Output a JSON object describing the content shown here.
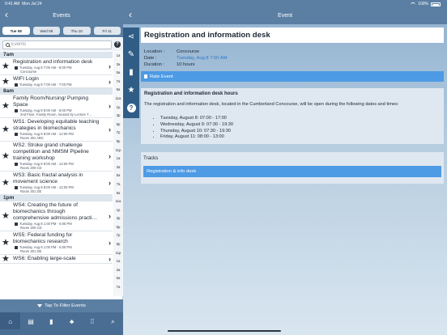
{
  "status_bar": {
    "time": "9:41 AM",
    "date": "Mon Jul 24",
    "battery": "100%"
  },
  "left": {
    "back": "‹",
    "title": "Events",
    "days": [
      {
        "label": "Tue 08",
        "active": true
      },
      {
        "label": "Wed 09",
        "active": false
      },
      {
        "label": "Thu 10",
        "active": false
      },
      {
        "label": "Fri 11",
        "active": false
      }
    ],
    "search_placeholder": "Events",
    "help": "?",
    "sections": [
      {
        "header": "7am",
        "events": [
          {
            "title": "Registration and information desk",
            "time": "Tuesday, Aug 8 7:00 AM - 5:00 PM",
            "location": "Concourse"
          },
          {
            "title": "WIFI Login",
            "time": "Tuesday, Aug 8 7:00 AM - 7:00 PM",
            "location": ""
          }
        ]
      },
      {
        "header": "8am",
        "events": [
          {
            "title": "Family Room/Nursing/ Pumping Space",
            "time": "Tuesday, Aug 8 8:00 AM - 6:00 PM",
            "location": "2nd Floor, Family Room, located by Lecture T…"
          },
          {
            "title": "WS1: Developing equitable teaching strategies in biomechanics",
            "time": "Tuesday, Aug 8 8:00 AM - 12:00 PM",
            "location": "Room 301 ABC"
          },
          {
            "title": "WS2: Stroke grand challenge competition and NMSM Pipeline training workshop",
            "time": "Tuesday, Aug 8 8:00 AM - 12:00 PM",
            "location": "Room 200 CD"
          },
          {
            "title": "WS3: Basic fractal analysis in movement science",
            "time": "Tuesday, Aug 8 8:00 AM - 12:00 PM",
            "location": "Room 301 DE"
          }
        ]
      },
      {
        "header": "1pm",
        "events": [
          {
            "title": "WS4: Creating the future of biomechanics through comprehensive admissions practi…",
            "time": "Tuesday, Aug 8 1:00 PM - 5:00 PM",
            "location": "Room 200 CD"
          },
          {
            "title": "WS5: Federal funding for biomechanics research",
            "time": "Tuesday, Aug 8 1:00 PM - 5:00 PM",
            "location": "Room 301 DE"
          },
          {
            "title": "WS6: Enabling large-scale",
            "time": "",
            "location": ""
          }
        ]
      }
    ],
    "index": [
      "1a",
      "3a",
      "5a",
      "7a",
      "9a",
      "11a",
      "1p",
      "3p",
      "5p",
      "7p",
      "9p",
      "11p",
      "1a",
      "3a",
      "5a",
      "7a",
      "9a",
      "11a",
      "1p",
      "3p",
      "5p",
      "7p",
      "9p",
      "11p",
      "1a",
      "3a",
      "5a",
      "7a"
    ],
    "filter_label": "Tap To Filter Events",
    "tabs": [
      "home",
      "store",
      "doc",
      "people",
      "grid",
      "search"
    ]
  },
  "right": {
    "back": "‹",
    "title": "Event",
    "event_title": "Registration and information desk",
    "location_label": "Location :",
    "location": "Concourse",
    "date_label": "Date :",
    "date": "Tuesday, Aug 8 7:00 AM",
    "duration_label": "Duration :",
    "duration": "10 hours",
    "rate_label": "Rate Event",
    "hours_title": "Registration and information desk hours",
    "hours_intro": "The registration and information desk, located in the Cumberland Concourse, will be open during the following dates and times:",
    "hours": [
      "Tuesday, August 8: 07:00 - 17:00",
      "Wednesday, August 9: 07:30 - 19:30",
      "Thursday, August 10: 07:30 - 19:30",
      "Friday, August 11: 08:00 - 13:00"
    ],
    "tracks_title": "Tracks",
    "track": "Registration & info desk"
  }
}
